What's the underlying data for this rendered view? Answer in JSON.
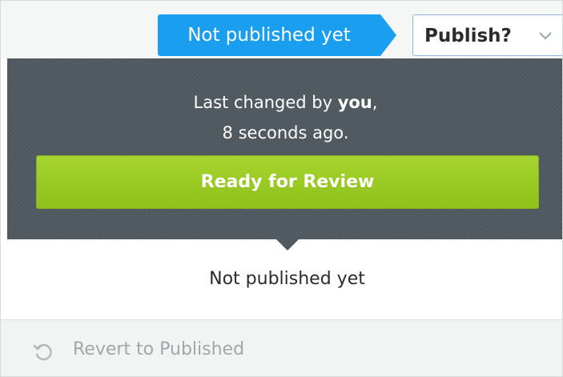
{
  "header": {
    "status_label": "Not published yet",
    "publish_select": {
      "selected": "Publish?"
    }
  },
  "panel": {
    "changed_prefix": "Last changed by ",
    "changed_user": "you",
    "changed_suffix": ",",
    "changed_time": "8 seconds ago.",
    "review_button_label": "Ready for Review"
  },
  "status": {
    "text": "Not published yet"
  },
  "footer": {
    "revert_label": "Revert to Published",
    "revert_icon": "revert-icon"
  },
  "colors": {
    "status_blue": "#1a9ef0",
    "review_green": "#96c91e",
    "panel_dark": "#50595f"
  }
}
